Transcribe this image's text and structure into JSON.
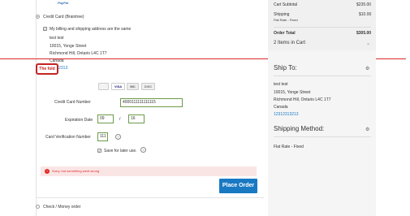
{
  "payment": {
    "paypal_logo": "PayPal",
    "braintree_label": "Credit Card (Braintree)",
    "same_address_label": "My billing and shipping address are the same",
    "address_lines": [
      "test test",
      "10015, Yonge Street",
      "Richmond Hill, Ontario L4C 1T7",
      "Canada",
      "12312313"
    ],
    "fold_label": "The fold",
    "card_logos": [
      "VISA",
      "MC",
      "DISC",
      "AMEX"
    ],
    "cc_number_label": "Credit Card Number",
    "cc_number_value": "4000111111111115",
    "expiration_label": "Expiration Date",
    "exp_month": "09",
    "exp_separator": "/",
    "exp_year": "16",
    "cvv_label": "Card Verification Number",
    "cvv_value": "111",
    "save_label": "Save for later use.",
    "error_text": "Sorry, but something went wrong",
    "place_order": "Place Order",
    "check_money_label": "Check / Money order"
  },
  "summary": {
    "subtotal_label": "Cart Subtotal",
    "subtotal_value": "$235.00",
    "shipping_label": "Shipping",
    "shipping_sub": "Flat Rate - Fixed",
    "shipping_value": "$10.00",
    "total_label": "Order Total",
    "total_value": "$305.00",
    "items_label": "2 Items in Cart"
  },
  "ship_to": {
    "heading": "Ship To:",
    "lines": [
      "test test",
      "10015, Yonge Street",
      "Richmond Hill, Ontario L4C 1T7",
      "Canada",
      "12312313213"
    ]
  },
  "shipping_method": {
    "heading": "Shipping Method:",
    "value": "Flat Rate - Fixed"
  },
  "colors": {
    "accent": "#1979c3",
    "error": "#e02b27",
    "fold_marker": "#c42323"
  }
}
